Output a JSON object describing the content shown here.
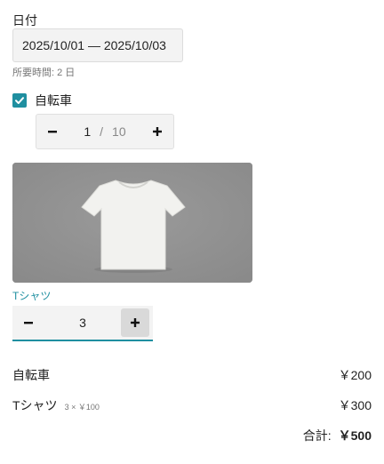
{
  "date_label": "日付",
  "date_range": "2025/10/01 — 2025/10/03",
  "duration": "所要時間: 2 日",
  "bike": {
    "checked": true,
    "label": "自転車",
    "quantity": "1",
    "separator": "/",
    "max": "10"
  },
  "tshirt": {
    "name": "Tシャツ",
    "quantity": "3"
  },
  "summary": {
    "bike_label": "自転車",
    "bike_price": "￥200",
    "tshirt_label": "Tシャツ",
    "tshirt_detail": "3 × ￥100",
    "tshirt_price": "￥300",
    "total_label": "合計:",
    "total_value": "￥500"
  },
  "colors": {
    "accent": "#1f8fa0"
  },
  "icons": {
    "checkbox": "check-icon",
    "minus": "minus-icon",
    "plus": "plus-icon"
  }
}
